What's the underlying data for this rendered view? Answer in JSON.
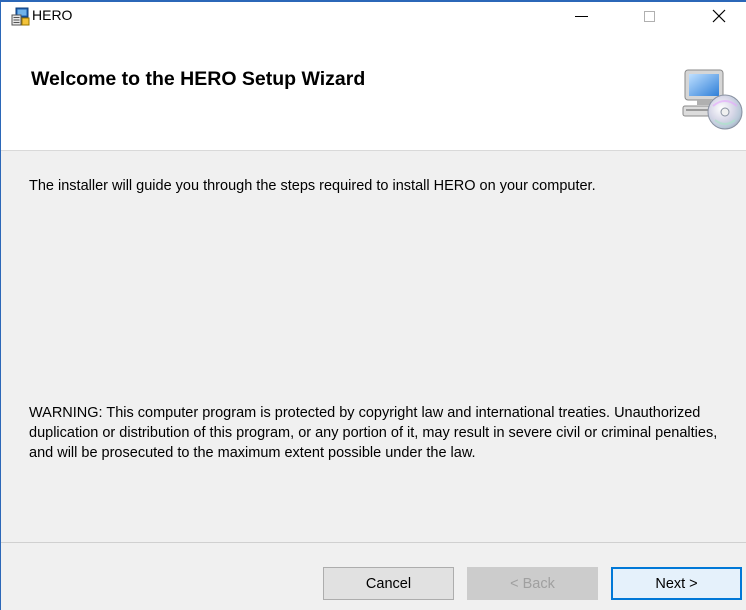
{
  "window": {
    "title": "HERO",
    "controls": {
      "minimize": "minimize",
      "maximize": "maximize",
      "close": "close"
    }
  },
  "header": {
    "title": "Welcome to the HERO Setup Wizard",
    "icon": "setup-computer-cd-icon"
  },
  "body": {
    "intro": "The installer will guide you through the steps required to install HERO on your computer.",
    "warning": "WARNING: This computer program is protected by copyright law and international treaties. Unauthorized duplication or distribution of this program, or any portion of it, may result in severe civil or criminal penalties, and will be prosecuted to the maximum extent possible under the law."
  },
  "buttons": {
    "cancel": "Cancel",
    "back": "< Back",
    "next": "Next >"
  },
  "colors": {
    "accent": "#0078d7",
    "window_border": "#2b67b8",
    "disabled_text": "#a0a0a0"
  }
}
